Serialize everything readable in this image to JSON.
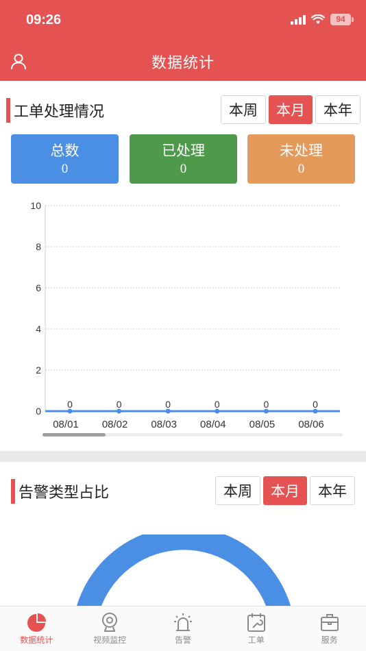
{
  "status_bar": {
    "time": "09:26",
    "battery": "94"
  },
  "header": {
    "title": "数据统计"
  },
  "work_orders": {
    "title": "工单处理情况",
    "periods": [
      "本周",
      "本月",
      "本年"
    ],
    "active_period": "本月",
    "stats": [
      {
        "label": "总数",
        "value": "0",
        "color": "#4a8fe4"
      },
      {
        "label": "已处理",
        "value": "0",
        "color": "#4f9a4a"
      },
      {
        "label": "未处理",
        "value": "0",
        "color": "#e39a5b"
      }
    ]
  },
  "chart_data": {
    "type": "line",
    "categories": [
      "08/01",
      "08/02",
      "08/03",
      "08/04",
      "08/05",
      "08/06"
    ],
    "series": [
      {
        "values": [
          0,
          0,
          0,
          0,
          0,
          0
        ],
        "color": "#4a8fe4"
      }
    ],
    "data_labels": [
      "0",
      "0",
      "0",
      "0",
      "0",
      "0"
    ],
    "yticks": [
      "0",
      "2",
      "4",
      "6",
      "8",
      "10"
    ],
    "ylim": [
      0,
      10
    ],
    "grid": true,
    "scroll_fraction": 0.21
  },
  "alarms": {
    "title": "告警类型占比",
    "periods": [
      "本周",
      "本月",
      "本年"
    ],
    "active_period": "本月",
    "donut_color": "#4a8fe4"
  },
  "tabbar": {
    "items": [
      {
        "label": "数据统计",
        "icon": "pie-chart-icon",
        "active": true
      },
      {
        "label": "视频监控",
        "icon": "camera-icon",
        "active": false
      },
      {
        "label": "告警",
        "icon": "alarm-light-icon",
        "active": false
      },
      {
        "label": "工单",
        "icon": "wrench-calendar-icon",
        "active": false
      },
      {
        "label": "服务",
        "icon": "briefcase-icon",
        "active": false
      }
    ]
  }
}
